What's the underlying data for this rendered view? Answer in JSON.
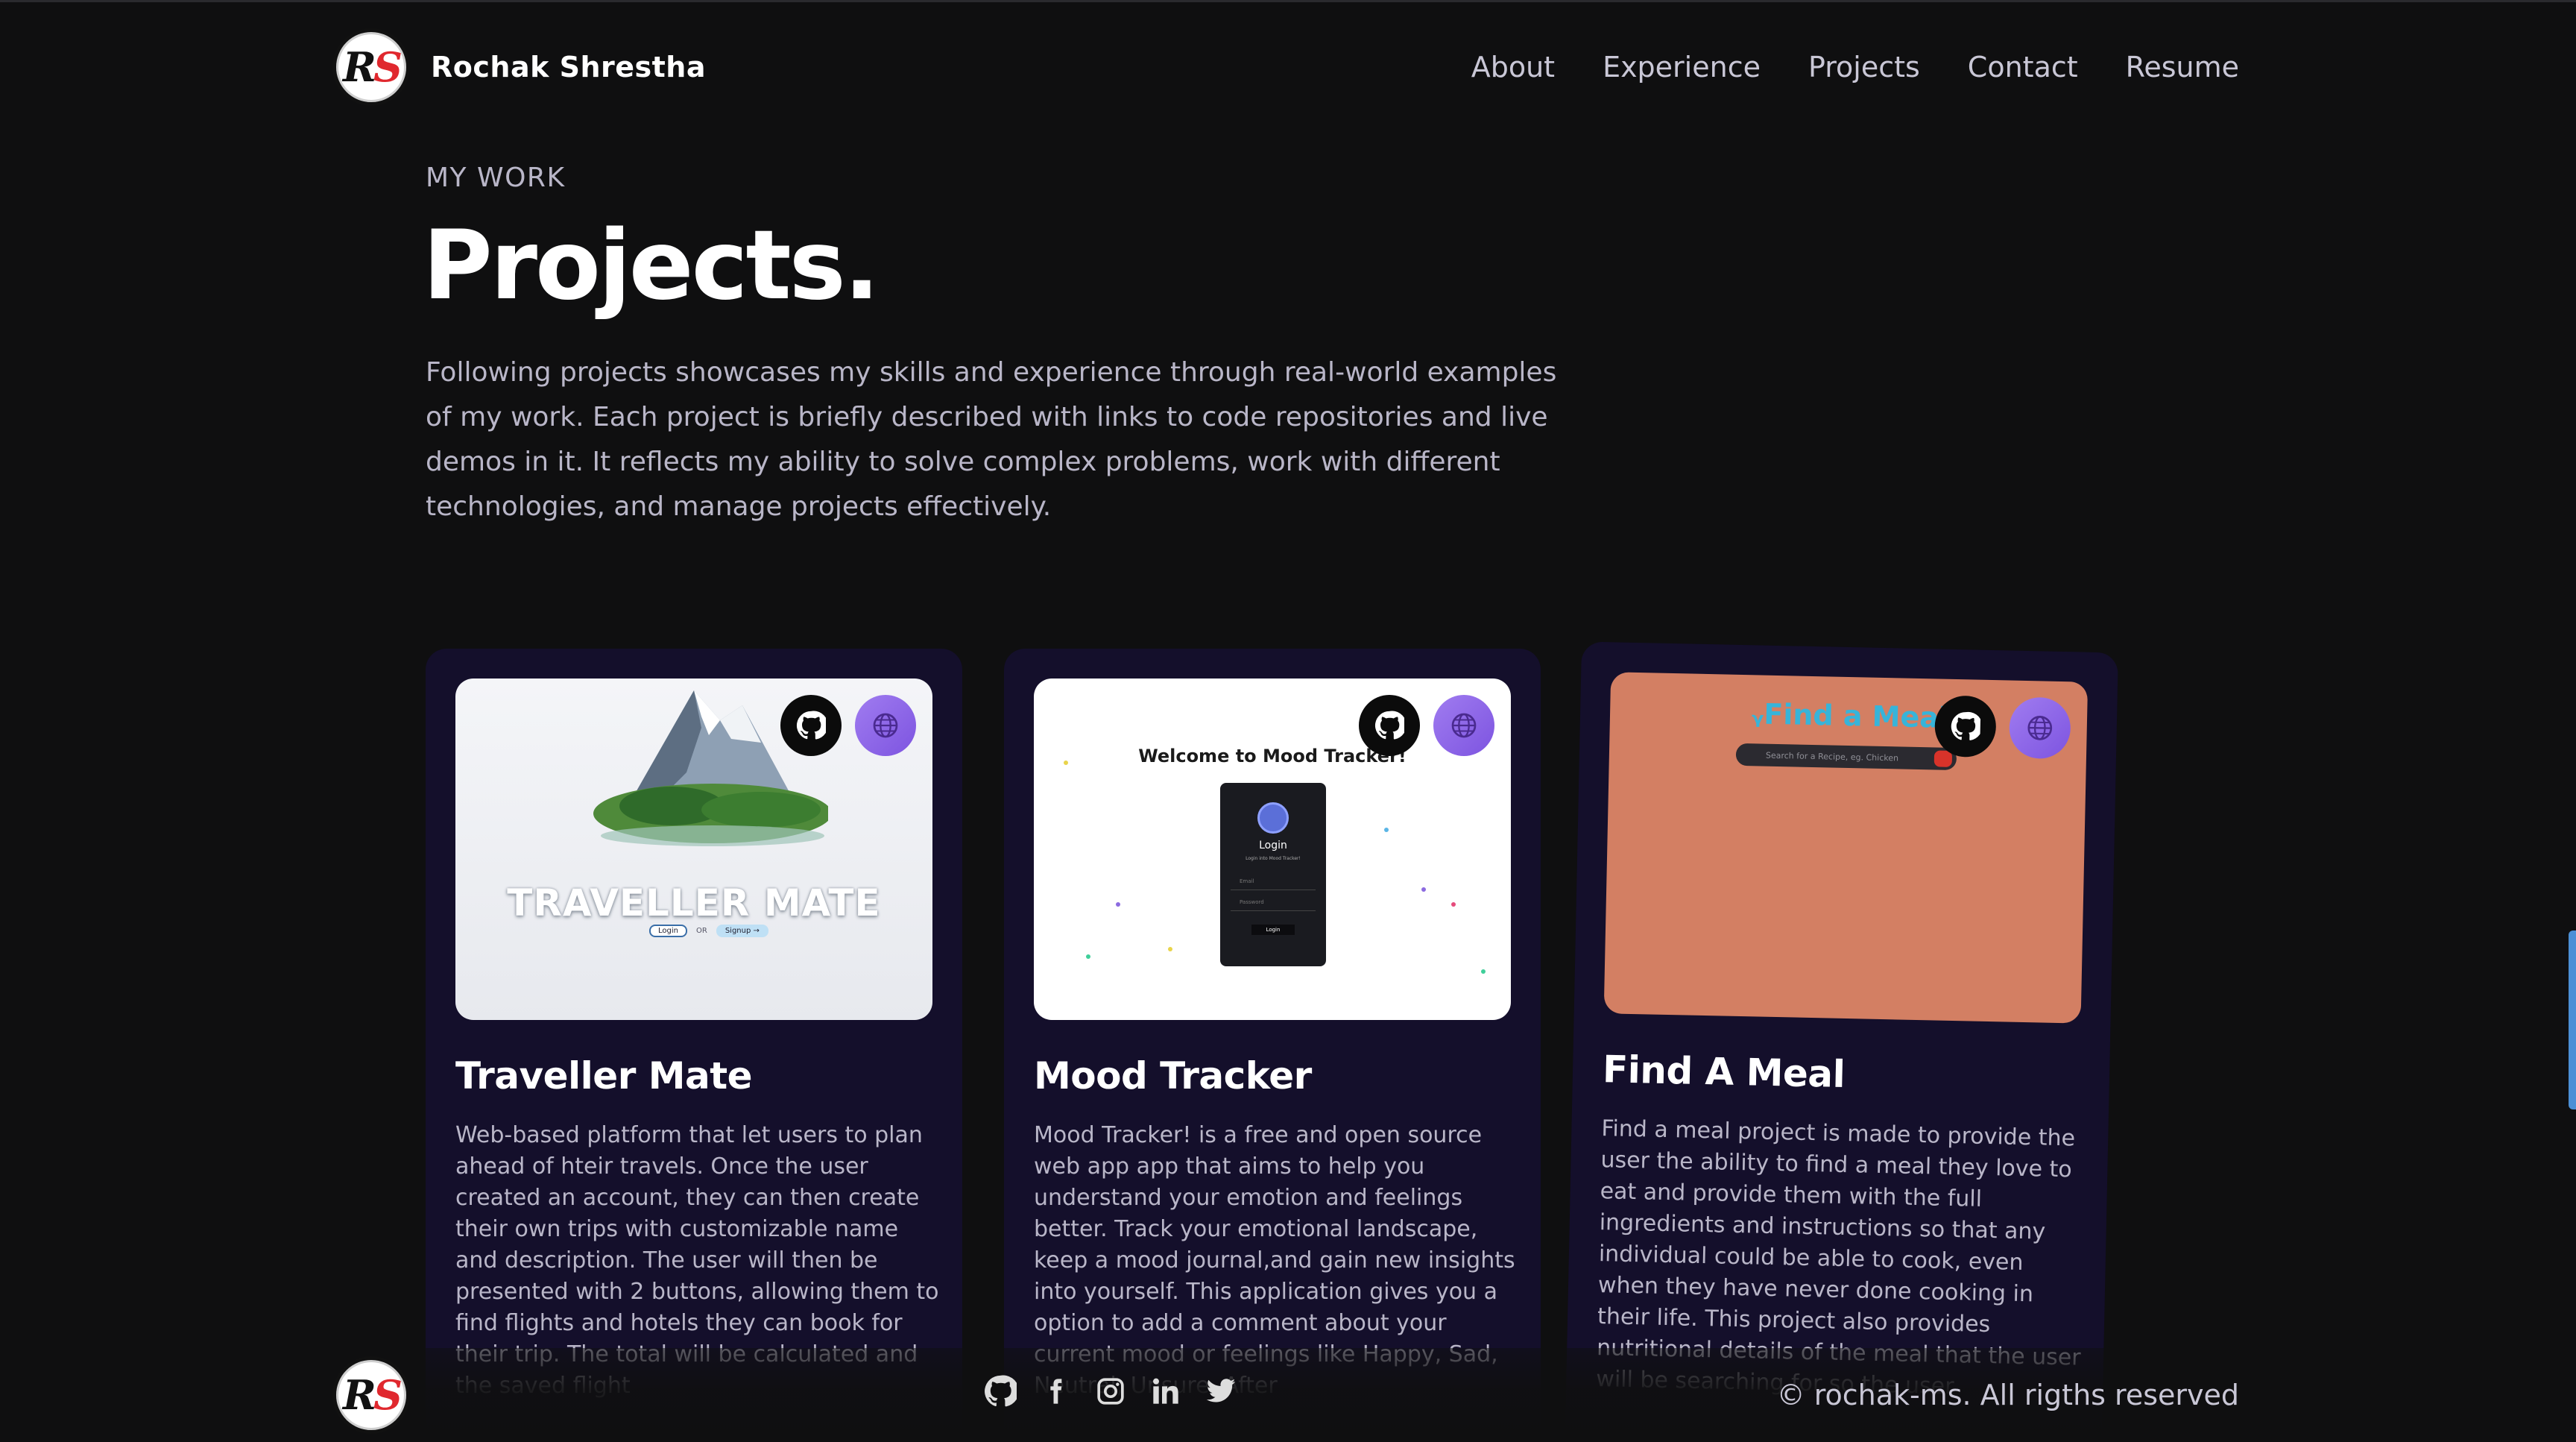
{
  "nav": {
    "logo_text_r": "R",
    "logo_text_s": "S",
    "brand": "Rochak Shrestha",
    "links": [
      "About",
      "Experience",
      "Projects",
      "Contact",
      "Resume"
    ]
  },
  "hero": {
    "eyebrow": "MY WORK",
    "title": "Projects.",
    "intro": "Following projects showcases my skills and experience through real-world examples of my work. Each project is briefly described with links to code repositories and live demos in it. It reflects my ability to solve complex problems, work with different technologies, and manage projects effectively."
  },
  "projects": [
    {
      "title": "Traveller Mate",
      "image_caption": "TRAVELLER MATE",
      "image_buttons": [
        "Login",
        "OR",
        "Signup →"
      ],
      "description": "Web-based platform that let users to plan ahead of hteir travels. Once the user created an account, they can then create their own trips with customizable name and description. The user will then be presented with 2 buttons, allowing them to find flights and hotels they can book for their trip. The total will be calculated and the saved flight"
    },
    {
      "title": "Mood Tracker",
      "image_heading": "Welcome to Mood Tracker!",
      "image_login": "Login",
      "image_sub": "Login into Mood Tracker!",
      "image_email": "Email",
      "image_password": "Password",
      "image_btn": "Login",
      "description": "Mood Tracker! is a free and open source web app app that aims to help you understand your emotion and feelings better. Track your emotional landscape, keep a mood journal,and gain new insights into yourself. This application gives you a option to add a comment about your current mood or feelings like Happy, Sad, Neutral, Unsure. After"
    },
    {
      "title": "Find A Meal",
      "image_logo": "Find a Meal",
      "image_search": "Search for a Recipe, eg. Chicken",
      "description": "Find a meal project is made to provide the user the ability to find a meal they love to eat and provide them with the full ingredients and instructions so that any individual could be able to cook, even when they have never done cooking in their life. This project also provides nutritional details of the meal that the user will be searching for so the user"
    }
  ],
  "footer": {
    "socials": [
      "github-icon",
      "facebook-icon",
      "instagram-icon",
      "linkedin-icon",
      "twitter-icon"
    ],
    "copyright": "© rochak-ms. All rigths reserved"
  },
  "colors": {
    "background": "#0f0f10",
    "card": "#140f2b",
    "text_muted": "#b9b6c8",
    "accent_purple": "#8b62e8",
    "meal_card": "#d37f63"
  }
}
